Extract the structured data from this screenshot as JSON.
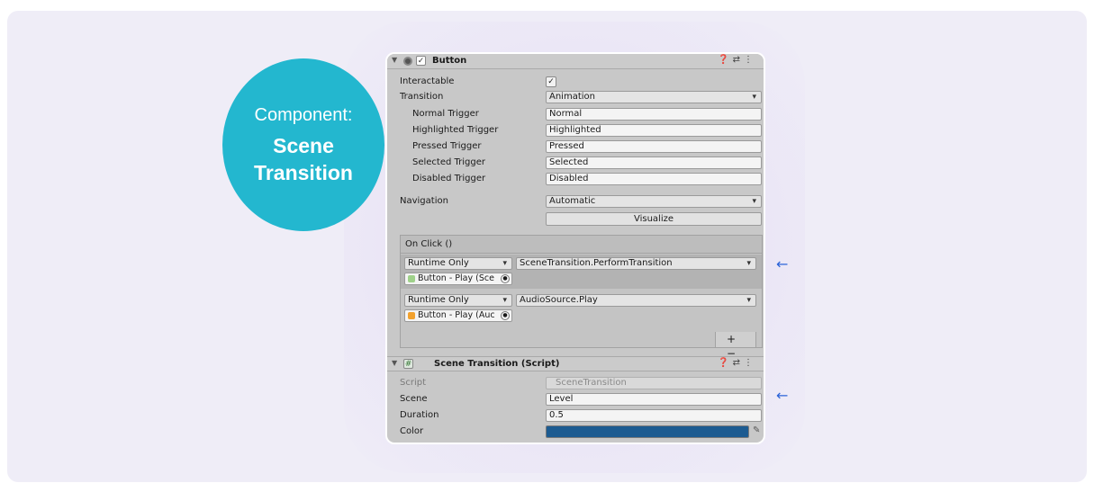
{
  "badge": {
    "line1": "Component:",
    "line2": "Scene",
    "line3": "Transition"
  },
  "button_component": {
    "title": "Button",
    "enabled_check": "✓",
    "header_icons": "❓⇄⋮",
    "interactable_label": "Interactable",
    "interactable_check": "✓",
    "transition_label": "Transition",
    "transition_value": "Animation",
    "triggers": [
      {
        "label": "Normal Trigger",
        "value": "Normal"
      },
      {
        "label": "Highlighted Trigger",
        "value": "Highlighted"
      },
      {
        "label": "Pressed Trigger",
        "value": "Pressed"
      },
      {
        "label": "Selected Trigger",
        "value": "Selected"
      },
      {
        "label": "Disabled Trigger",
        "value": "Disabled"
      }
    ],
    "navigation_label": "Navigation",
    "navigation_value": "Automatic",
    "visualize_label": "Visualize"
  },
  "on_click": {
    "title": "On Click ()",
    "events": [
      {
        "mode": "Runtime Only",
        "function": "SceneTransition.PerformTransition",
        "target": "Button - Play (Sce",
        "icon_color": "#9fd18a"
      },
      {
        "mode": "Runtime Only",
        "function": "AudioSource.Play",
        "target": "Button - Play (Auc",
        "icon_color": "#f2a12d"
      }
    ],
    "add_remove": "+ −"
  },
  "script_component": {
    "title": "Scene Transition (Script)",
    "icon": "#",
    "header_icons": "❓⇄⋮",
    "script_label": "Script",
    "script_value": "SceneTransition",
    "scene_label": "Scene",
    "scene_value": "Level",
    "duration_label": "Duration",
    "duration_value": "0.5",
    "color_label": "Color",
    "color_value": "#1c5b91"
  },
  "colors": {
    "badge": "#23b7cf",
    "arrow": "#2c64d8",
    "card": "#efedf7"
  }
}
